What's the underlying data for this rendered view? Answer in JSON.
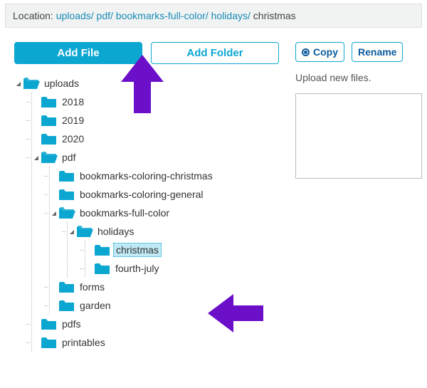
{
  "breadcrumb": {
    "label": "Location:",
    "parts": [
      "uploads",
      "pdf",
      "bookmarks-full-color",
      "holidays",
      "christmas"
    ]
  },
  "buttons": {
    "add_file": "Add File",
    "add_folder": "Add Folder",
    "copy": "Copy",
    "rename": "Rename"
  },
  "upload_panel": {
    "title": "Upload new files."
  },
  "tree": {
    "name": "uploads",
    "open": true,
    "children": [
      {
        "name": "2018",
        "open": false
      },
      {
        "name": "2019",
        "open": false
      },
      {
        "name": "2020",
        "open": false
      },
      {
        "name": "pdf",
        "open": true,
        "children": [
          {
            "name": "bookmarks-coloring-christmas",
            "open": false
          },
          {
            "name": "bookmarks-coloring-general",
            "open": false
          },
          {
            "name": "bookmarks-full-color",
            "open": true,
            "children": [
              {
                "name": "holidays",
                "open": true,
                "children": [
                  {
                    "name": "christmas",
                    "open": false,
                    "selected": true
                  },
                  {
                    "name": "fourth-july",
                    "open": false
                  }
                ]
              }
            ]
          },
          {
            "name": "forms",
            "open": false
          },
          {
            "name": "garden",
            "open": false
          }
        ]
      },
      {
        "name": "pdfs",
        "open": false
      },
      {
        "name": "printables",
        "open": false
      }
    ]
  },
  "icons": {
    "folder_color": "#0ca7d1"
  },
  "annotations": {
    "arrow_color": "#6b0fc9"
  }
}
